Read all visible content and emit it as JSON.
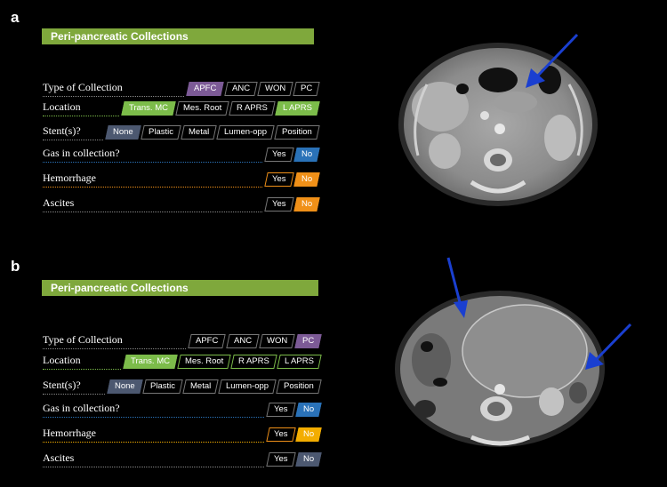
{
  "panels": [
    {
      "letter": "a",
      "header": "Peri-pancreatic Collections",
      "rows": [
        {
          "label": "Type of Collection",
          "line": "#888888",
          "options": [
            {
              "text": "APFC",
              "style": "sel-purple"
            },
            {
              "text": "ANC",
              "style": ""
            },
            {
              "text": "WON",
              "style": ""
            },
            {
              "text": "PC",
              "style": ""
            }
          ]
        },
        {
          "label": "Location",
          "line": "#7cbc4a",
          "options": [
            {
              "text": "Trans. MC",
              "style": "sel-green"
            },
            {
              "text": "Mes. Root",
              "style": ""
            },
            {
              "text": "R APRS",
              "style": ""
            },
            {
              "text": "L APRS",
              "style": "sel-green"
            }
          ]
        },
        {
          "label": "Stent(s)?",
          "line": "#888888",
          "options": [
            {
              "text": "None",
              "style": "sel-slate"
            },
            {
              "text": "Plastic",
              "style": ""
            },
            {
              "text": "Metal",
              "style": ""
            },
            {
              "text": "Lumen-opp",
              "style": ""
            },
            {
              "text": "Position",
              "style": ""
            }
          ]
        },
        {
          "label": "Gas in collection?",
          "line": "#2a72b8",
          "options": [
            {
              "text": "Yes",
              "style": ""
            },
            {
              "text": "No",
              "style": "sel-blue"
            }
          ]
        },
        {
          "label": "Hemorrhage",
          "line": "#f09018",
          "options": [
            {
              "text": "Yes",
              "style": "out-orange"
            },
            {
              "text": "No",
              "style": "sel-orange"
            }
          ]
        },
        {
          "label": "Ascites",
          "line": "#888888",
          "options": [
            {
              "text": "Yes",
              "style": ""
            },
            {
              "text": "No",
              "style": "sel-orange"
            }
          ]
        }
      ]
    },
    {
      "letter": "b",
      "header": "Peri-pancreatic Collections",
      "rows": [
        {
          "label": "Type of Collection",
          "line": "#888888",
          "options": [
            {
              "text": "APFC",
              "style": ""
            },
            {
              "text": "ANC",
              "style": ""
            },
            {
              "text": "WON",
              "style": ""
            },
            {
              "text": "PC",
              "style": "sel-purple"
            }
          ]
        },
        {
          "label": "Location",
          "line": "#7cbc4a",
          "options": [
            {
              "text": "Trans. MC",
              "style": "sel-green"
            },
            {
              "text": "Mes. Root",
              "style": "out-green"
            },
            {
              "text": "R APRS",
              "style": "out-green"
            },
            {
              "text": "L APRS",
              "style": "out-green"
            }
          ]
        },
        {
          "label": "Stent(s)?",
          "line": "#888888",
          "options": [
            {
              "text": "None",
              "style": "sel-slate"
            },
            {
              "text": "Plastic",
              "style": ""
            },
            {
              "text": "Metal",
              "style": ""
            },
            {
              "text": "Lumen-opp",
              "style": ""
            },
            {
              "text": "Position",
              "style": ""
            }
          ]
        },
        {
          "label": "Gas in collection?",
          "line": "#2a72b8",
          "options": [
            {
              "text": "Yes",
              "style": ""
            },
            {
              "text": "No",
              "style": "sel-blue"
            }
          ]
        },
        {
          "label": "Hemorrhage",
          "line": "#f3ad00",
          "options": [
            {
              "text": "Yes",
              "style": "out-orange"
            },
            {
              "text": "No",
              "style": "sel-yellow"
            }
          ]
        },
        {
          "label": "Ascites",
          "line": "#888888",
          "options": [
            {
              "text": "Yes",
              "style": ""
            },
            {
              "text": "No",
              "style": "sel-slate"
            }
          ]
        }
      ]
    }
  ],
  "ct_images": [
    {
      "name": "ct-scan-a",
      "arrow_color": "#1a3fd0"
    },
    {
      "name": "ct-scan-b",
      "arrow_color": "#1a3fd0"
    }
  ]
}
